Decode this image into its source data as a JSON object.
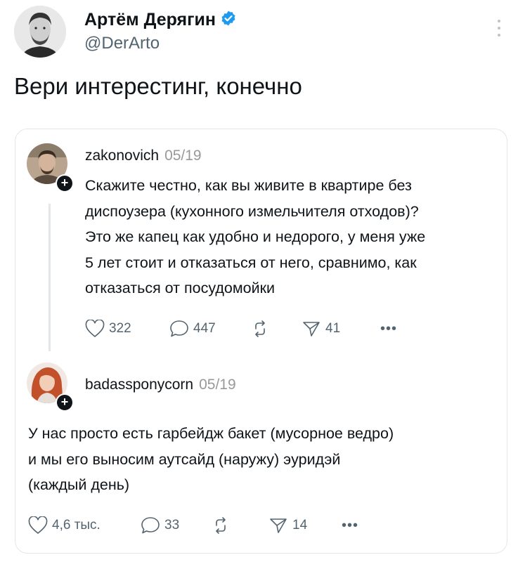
{
  "tweet": {
    "author_name": "Артём Дерягин",
    "author_handle": "@DerArto",
    "text": "Вери интерестинг, конечно"
  },
  "quoted_thread": {
    "posts": [
      {
        "username": "zakonovich",
        "date": "05/19",
        "lines": [
          "Скажите честно, как вы живите в квартире без",
          "диспоузера (кухонного измельчителя отходов)?",
          "Это же капец как удобно и недорого, у меня уже",
          "5 лет стоит и отказаться от него, сравнимо, как",
          "отказаться от посудомойки"
        ],
        "likes": "322",
        "replies": "447",
        "shares": "41"
      },
      {
        "username": "badassponycorn",
        "date": "05/19",
        "lines": [
          "У нас просто есть гарбейдж бакет (мусорное ведро)",
          "и мы его выносим аутсайд (наружу) эуридэй",
          "(каждый день)"
        ],
        "likes": "4,6 тыс.",
        "replies": "33",
        "shares": "14"
      }
    ]
  },
  "colors": {
    "verified_blue": "#1d9bf0",
    "text_primary": "#0f1419",
    "text_secondary": "#536471",
    "border": "#e4e7ea"
  }
}
